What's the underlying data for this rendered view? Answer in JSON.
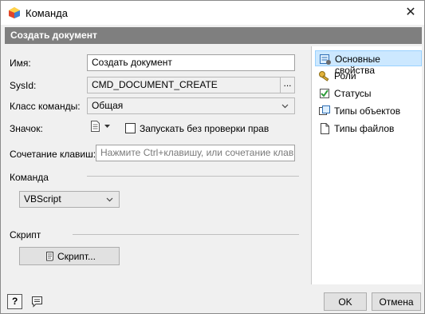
{
  "window": {
    "title": "Команда",
    "close_glyph": "✕"
  },
  "header": {
    "title": "Создать документ"
  },
  "form": {
    "name_label": "Имя:",
    "name_value": "Создать документ",
    "sysid_label": "SysId:",
    "sysid_value": "CMD_DOCUMENT_CREATE",
    "sysid_button": "...",
    "class_label": "Класс команды:",
    "class_value": "Общая",
    "icon_label": "Значок:",
    "run_check_label": "Запускать без проверки прав",
    "run_check_checked": false,
    "shortcut_label": "Сочетание клавиш:",
    "shortcut_placeholder": "Нажмите Ctrl+клавишу, или сочетание клавиш",
    "command_section": "Команда",
    "language_value": "VBScript",
    "script_section": "Скрипт",
    "script_button": "Скрипт..."
  },
  "nav": {
    "items": [
      {
        "label": "Основные свойства",
        "icon": "properties-icon",
        "active": true
      },
      {
        "label": "Роли",
        "icon": "key-icon",
        "active": false
      },
      {
        "label": "Статусы",
        "icon": "status-icon",
        "active": false
      },
      {
        "label": "Типы объектов",
        "icon": "object-types-icon",
        "active": false
      },
      {
        "label": "Типы файлов",
        "icon": "file-types-icon",
        "active": false
      }
    ]
  },
  "footer": {
    "ok_label": "OK",
    "cancel_label": "Отмена",
    "help_glyph": "?"
  },
  "colors": {
    "header_bg": "#7f7f7f",
    "nav_active_bg": "#cce8ff",
    "nav_active_border": "#99d1ff"
  }
}
